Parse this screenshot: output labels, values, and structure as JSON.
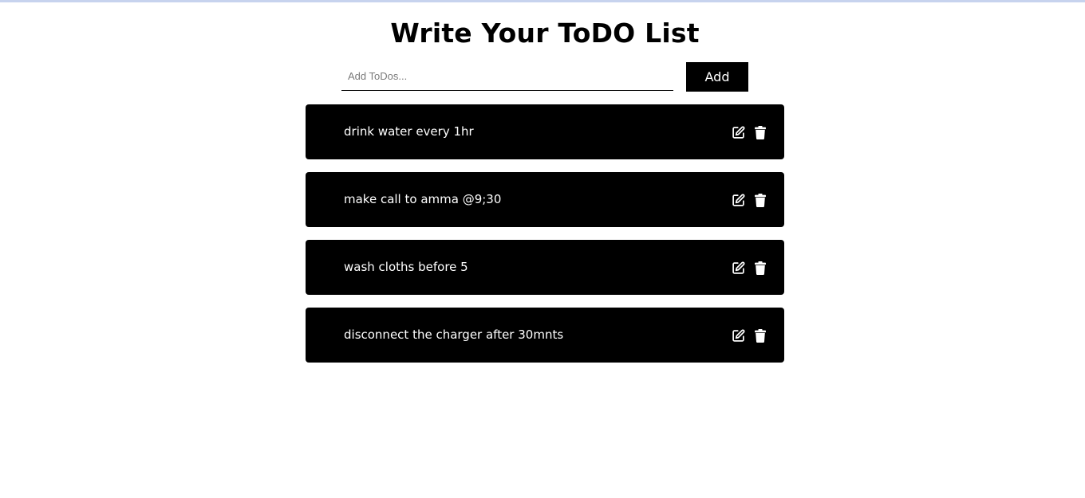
{
  "header": {
    "title": "Write Your ToDO List"
  },
  "add_form": {
    "placeholder": "Add ToDos...",
    "value": "",
    "button_label": "Add"
  },
  "todos": [
    {
      "text": "drink water every 1hr"
    },
    {
      "text": "make call to amma @9;30"
    },
    {
      "text": "wash cloths before 5"
    },
    {
      "text": "disconnect the charger after 30mnts"
    }
  ],
  "icons": {
    "edit": "edit-icon",
    "delete": "trash-icon"
  },
  "colors": {
    "card_background": "#000000",
    "card_text": "#ffffff",
    "button_background": "#000000",
    "page_background": "#ffffff"
  }
}
